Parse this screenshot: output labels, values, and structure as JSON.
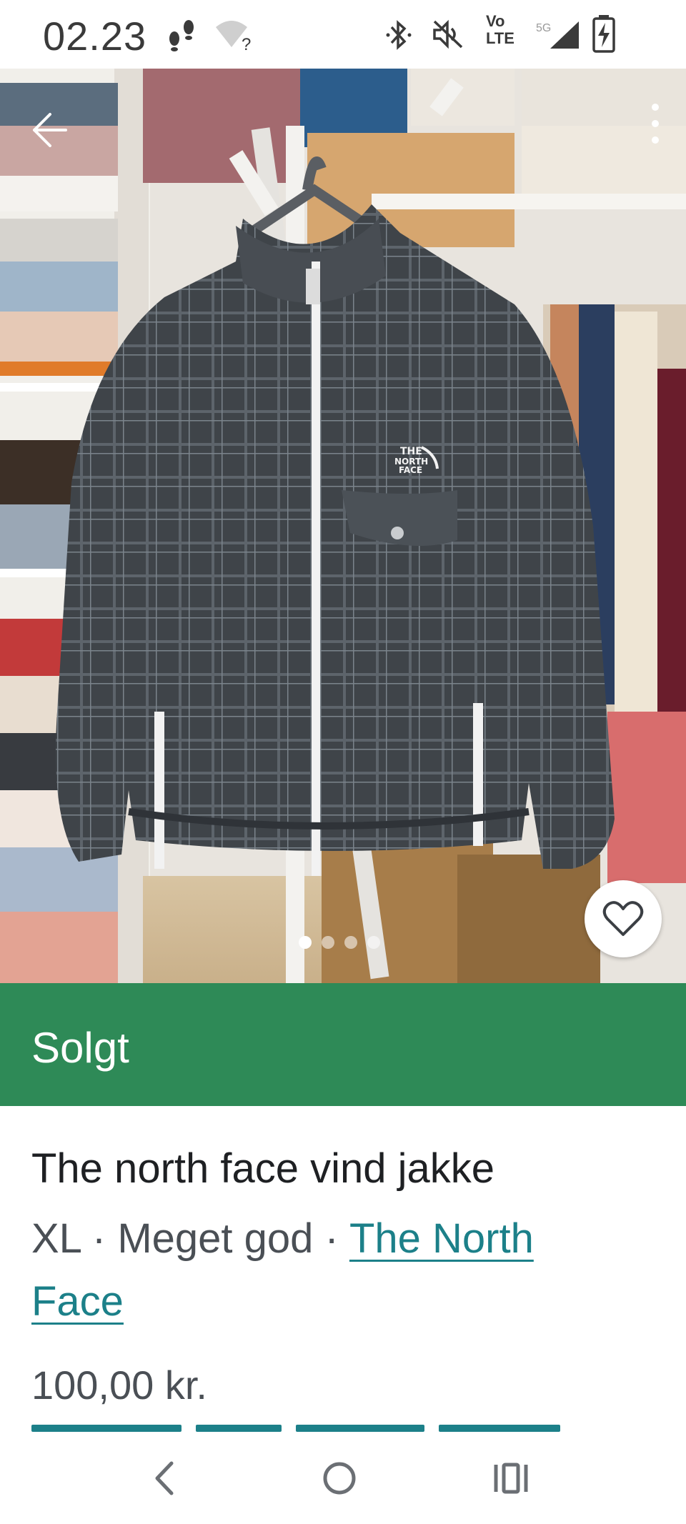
{
  "status_bar": {
    "time": "02.23",
    "network_label_top": "Vo",
    "network_label_bottom": "LTE",
    "icons": [
      "footsteps-icon",
      "wifi-unknown-icon",
      "bluetooth-icon",
      "mute-icon",
      "volte-icon",
      "signal-5g-icon",
      "battery-charging-icon"
    ]
  },
  "gallery": {
    "image_description_icon": "jacket-photo",
    "page_count": 4,
    "current_page": 1
  },
  "listing": {
    "status": "Solgt",
    "title": "The north face vind jakke",
    "size": "XL",
    "separator": " · ",
    "condition": "Meget god",
    "brand": "The North Face",
    "price": "100,00 kr."
  },
  "colors": {
    "sold_banner": "#2e8a57",
    "brand_link": "#1c8089",
    "text_primary": "#1e2023",
    "text_secondary": "#4a4f55"
  }
}
